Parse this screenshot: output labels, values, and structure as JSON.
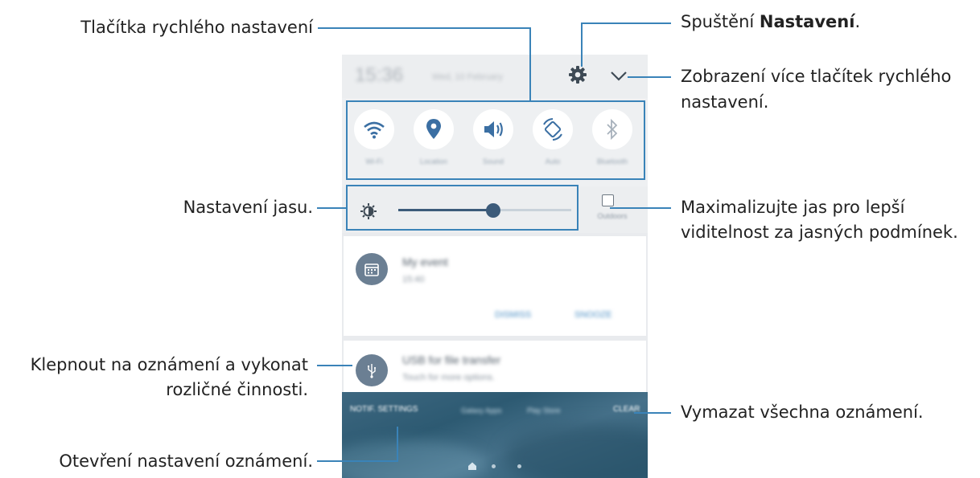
{
  "callouts": {
    "quick_settings_buttons": "Tlačítka rychlého nastavení",
    "brightness": "Nastavení jasu.",
    "notification_tap_line1": "Klepnout na oznámení a vykonat",
    "notification_tap_line2": "rozličné činnosti.",
    "notification_settings": "Otevření nastavení oznámení.",
    "launch_settings_prefix": "Spuštění ",
    "launch_settings_bold": "Nastavení",
    "launch_settings_suffix": ".",
    "more_buttons_line1": "Zobrazení více tlačítek rychlého",
    "more_buttons_line2": "nastavení.",
    "outdoor_line1": "Maximalizujte jas pro lepší",
    "outdoor_line2": "viditelnost za jasných podmínek.",
    "clear_all": "Vymazat všechna oznámení."
  },
  "screen": {
    "status_time": "15:36",
    "status_date": "Wed, 10 February",
    "quick_buttons": [
      {
        "label": "Wi-Fi",
        "icon": "wifi-icon"
      },
      {
        "label": "Location",
        "icon": "location-pin-icon"
      },
      {
        "label": "Sound",
        "icon": "sound-icon"
      },
      {
        "label": "Auto",
        "icon": "auto-rotate-icon"
      },
      {
        "label": "Bluetooth",
        "icon": "bluetooth-icon"
      }
    ],
    "brightness_level": 0.55,
    "outdoor_label": "Outdoors",
    "event_title": "My event",
    "event_time": "15:40",
    "event_actions": [
      "DISMISS",
      "SNOOZE"
    ],
    "usb_title": "USB for file transfer",
    "usb_subtitle": "Touch for more options.",
    "notif_settings_button": "NOTIF. SETTINGS",
    "clear_button": "CLEAR",
    "home_apps": [
      "Galaxy Apps",
      "Play Store"
    ],
    "colors": {
      "accent": "#3a83b8",
      "slider": "#3c5b7a",
      "quick_icon": "#3b6fa3"
    }
  }
}
